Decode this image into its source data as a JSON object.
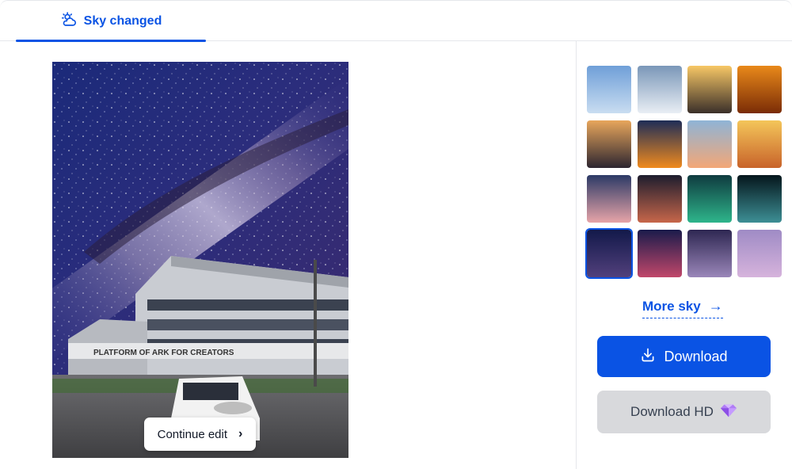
{
  "header": {
    "tab_label": "Sky changed",
    "tab_icon": "cloud-sun-icon",
    "accent": "#0a53e4"
  },
  "preview": {
    "building_sign": "PLATFORM OF ARK FOR CREATORS",
    "continue_label": "Continue edit",
    "continue_icon": "chevron-right-icon"
  },
  "skies": {
    "selected_index": 12,
    "items": [
      {
        "name": "light-blue-clouds",
        "top": "#6f9fd8",
        "bottom": "#c9ddf1"
      },
      {
        "name": "white-cumulus",
        "top": "#7a97b8",
        "bottom": "#e9eef4"
      },
      {
        "name": "sunset-over-clouds",
        "top": "#f7c766",
        "bottom": "#3a2f2a"
      },
      {
        "name": "orange-sunset",
        "top": "#e9891a",
        "bottom": "#7a2c06"
      },
      {
        "name": "golden-dusk",
        "top": "#e8a65c",
        "bottom": "#2d2630"
      },
      {
        "name": "sunrise-horizon",
        "top": "#1e2d57",
        "bottom": "#f08a1e"
      },
      {
        "name": "pastel-sunset-clouds",
        "top": "#8fb4d6",
        "bottom": "#f3a777"
      },
      {
        "name": "warm-gradient",
        "top": "#f4c65a",
        "bottom": "#c8632a"
      },
      {
        "name": "moon-dusk",
        "top": "#2c3a66",
        "bottom": "#e7a4a8"
      },
      {
        "name": "red-moon",
        "top": "#1d1d2e",
        "bottom": "#c7664a"
      },
      {
        "name": "aurora-green",
        "top": "#0f3b3f",
        "bottom": "#2eb58b"
      },
      {
        "name": "aurora-teal",
        "top": "#05161c",
        "bottom": "#3d8f95"
      },
      {
        "name": "milky-way",
        "top": "#12194a",
        "bottom": "#52407c"
      },
      {
        "name": "galaxy-pink",
        "top": "#1a1b4b",
        "bottom": "#c1476a"
      },
      {
        "name": "purple-night",
        "top": "#2e2752",
        "bottom": "#9a86b9"
      },
      {
        "name": "rainbow-lilac",
        "top": "#9f8bc5",
        "bottom": "#d6b3dc"
      }
    ]
  },
  "more_sky": {
    "label": "More sky",
    "icon": "arrow-right-icon"
  },
  "download": {
    "label": "Download",
    "icon": "download-icon",
    "color": "#0a53e4"
  },
  "download_hd": {
    "label": "Download HD",
    "icon": "diamond-gem-icon"
  }
}
